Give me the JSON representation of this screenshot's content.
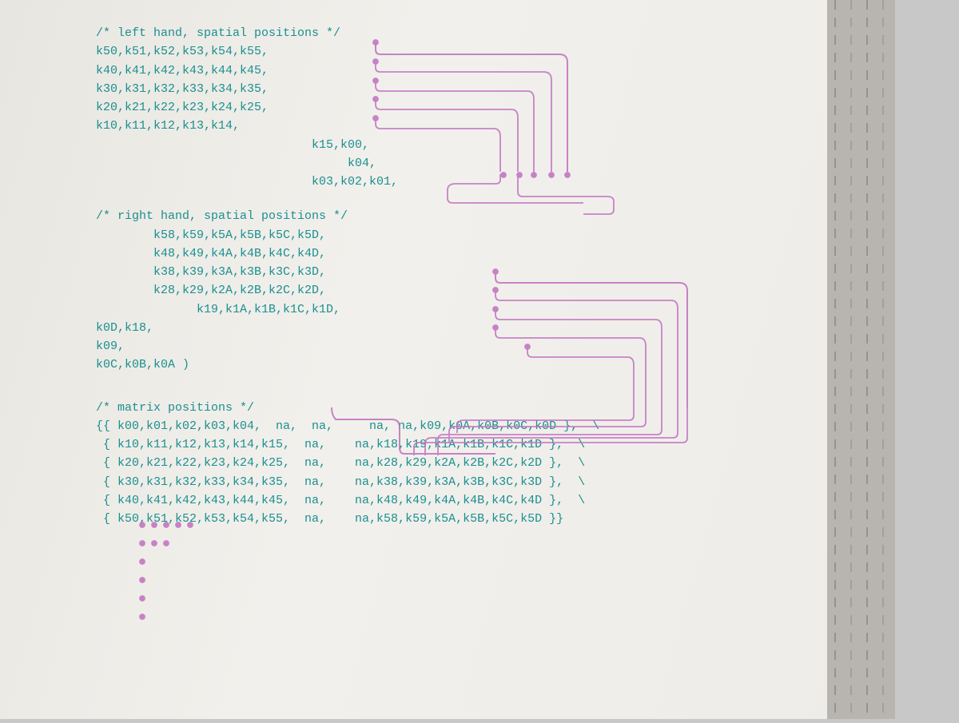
{
  "page": {
    "background_color": "#e8e6e2"
  },
  "left_hand": {
    "comment": "/* left hand, spatial positions */",
    "lines": [
      "k50,k51,k52,k53,k54,k55,",
      "k40,k41,k42,k43,k44,k45,",
      "k30,k31,k32,k33,k34,k35,",
      "k20,k21,k22,k23,k24,k25,",
      "k10,k11,k12,k13,k14,",
      "                              k15,k00,",
      "                                   k04,",
      "                              k03,k02,k01,"
    ]
  },
  "right_hand": {
    "comment": "/* right hand, spatial positions */",
    "lines": [
      "        k58,k59,k5A,k5B,k5C,k5D,",
      "        k48,k49,k4A,k4B,k4C,k4D,",
      "        k38,k39,k3A,k3B,k3C,k3D,",
      "        k28,k29,k2A,k2B,k2C,k2D,",
      "             k19,k1A,k1B,k1C,k1D,",
      "k0D,k18,",
      "k09,",
      "k0C,k0B,k0A )"
    ]
  },
  "matrix": {
    "comment": "/* matrix positions */",
    "rows": [
      "{{ k00,k01,k02,k03,k04, na,  na,    na, na,k09,k0A,k0B,k0C,k0D },",
      " { k10,k11,k12,k13,k14,k15, na,   na,k18,k19,k1A,k1B,k1C,k1D },",
      " { k20,k21,k22,k23,k24,k25, na,   na,k28,k29,k2A,k2B,k2C,k2D },",
      " { k30,k31,k32,k33,k34,k35, na,   na,k38,k39,k3A,k3B,k3C,k3D },",
      " { k40,k41,k42,k43,k44,k45, na,   na,k48,k49,k4A,k4B,k4C,k4D },",
      " { k50,k51,k52,k53,k54,k55, na,   na,k58,k59,k5A,k5B,k5C,k5D }}"
    ]
  }
}
